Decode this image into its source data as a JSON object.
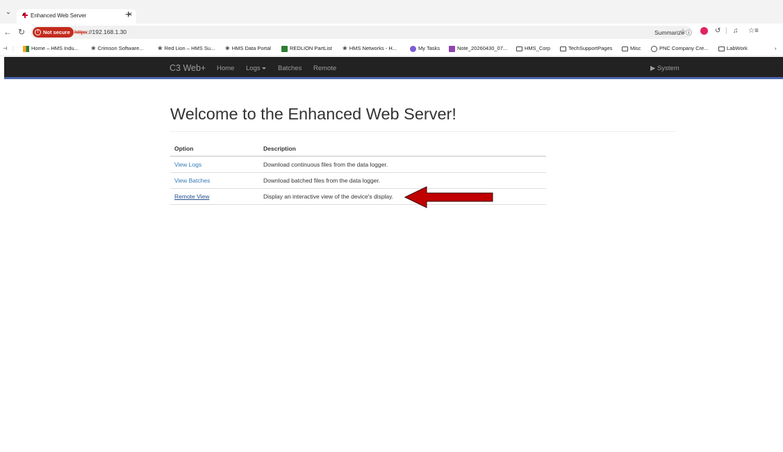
{
  "browser": {
    "tab": {
      "title": "Enhanced Web Server",
      "close": "×"
    },
    "new_tab": "+",
    "address": {
      "security_label": "Not secure",
      "scheme": "https",
      "host": "://192.168.1.30",
      "summarize_label": "Summarize"
    },
    "bookmarks": [
      {
        "label": "Home – HMS Indu...",
        "icon": "hms-icon"
      },
      {
        "label": "Crimson Software...",
        "icon": "redlion-icon"
      },
      {
        "label": "Red Lion – HMS Su...",
        "icon": "redlion-icon"
      },
      {
        "label": "HMS Data Portal",
        "icon": "redlion-icon"
      },
      {
        "label": "REDLION PartList",
        "icon": "sheet-icon"
      },
      {
        "label": "HMS Networks - H...",
        "icon": "redlion-icon"
      },
      {
        "label": "My Tasks",
        "icon": "heart-icon"
      },
      {
        "label": "Note_20260430_07...",
        "icon": "note-icon"
      },
      {
        "label": "HMS_Corp",
        "icon": "folder-icon"
      },
      {
        "label": "TechSupportPages",
        "icon": "folder-icon"
      },
      {
        "label": "Misc",
        "icon": "folder-icon"
      },
      {
        "label": "PNC Company Cre...",
        "icon": "globe-icon"
      },
      {
        "label": "LabWork",
        "icon": "folder-icon"
      }
    ],
    "colors": {
      "not_secure": "#c42b1c"
    }
  },
  "app": {
    "brand": "C3 Web+",
    "nav": {
      "home": "Home",
      "logs": "Logs",
      "batches": "Batches",
      "remote": "Remote",
      "system": "System"
    },
    "navbar_color": "#222222",
    "navbar_accent": "#4a66ad"
  },
  "main": {
    "title": "Welcome to the Enhanced Web Server!",
    "table": {
      "headers": {
        "option": "Option",
        "description": "Description"
      },
      "rows": [
        {
          "option": "View Logs",
          "description": "Download continuous files from the data logger."
        },
        {
          "option": "View Batches",
          "description": "Download batched files from the data logger."
        },
        {
          "option": "Remote View",
          "description": "Display an interactive view of the device's display."
        }
      ]
    },
    "annotation": {
      "icon": "red-arrow-icon",
      "color": "#c00000"
    }
  }
}
